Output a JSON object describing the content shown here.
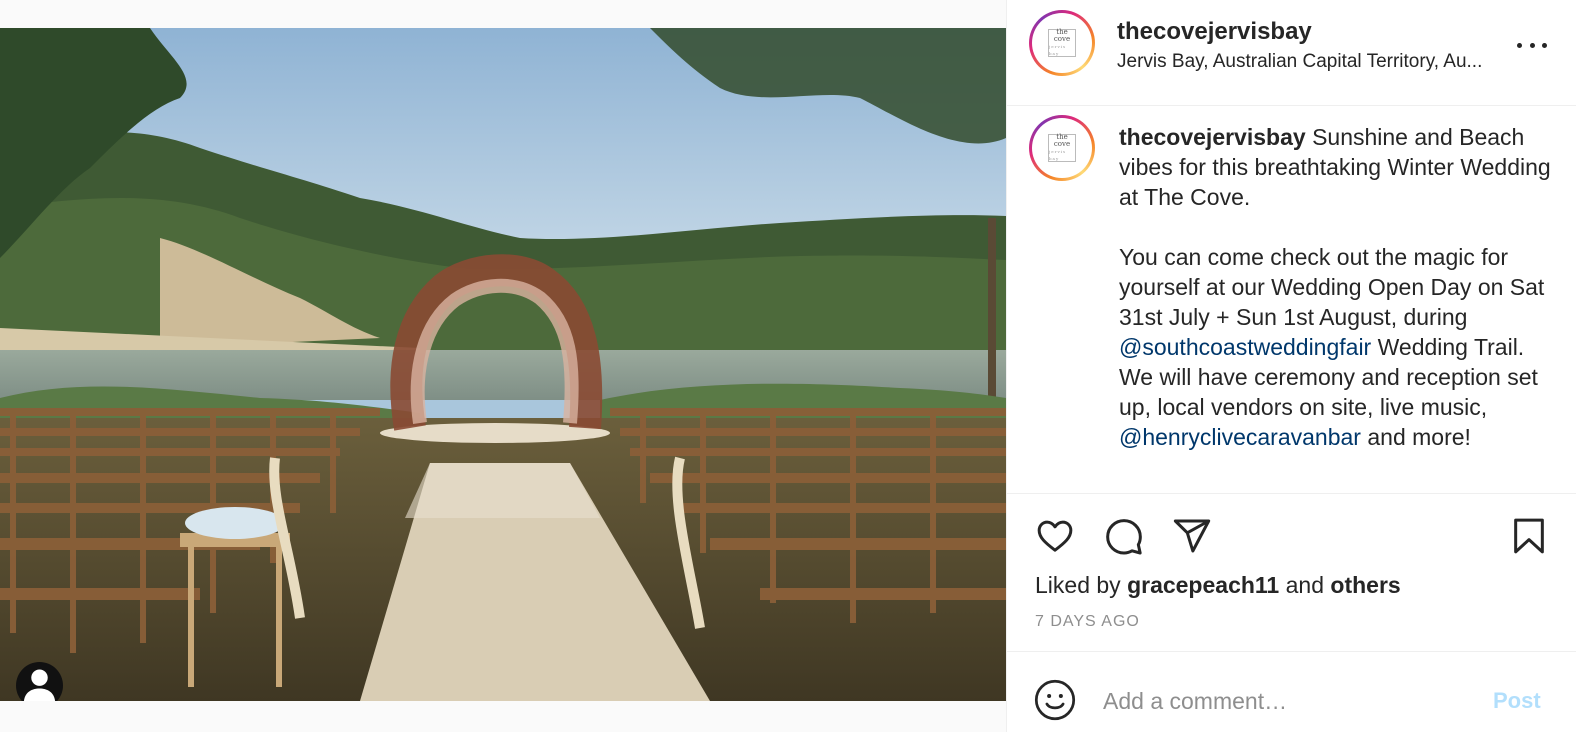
{
  "post": {
    "username": "thecovejervisbay",
    "location": "Jervis Bay, Australian Capital Territory, Au...",
    "avatar_logo_top": "the",
    "avatar_logo_mid": "cove",
    "avatar_logo_sub": "jervis bay"
  },
  "caption": {
    "username": "thecovejervisbay",
    "p1": "Sunshine and Beach vibes for this breathtaking Winter Wedding at The Cove.",
    "p2_a": "You can come check out the magic for yourself at our Wedding Open Day on Sat 31st July + Sun 1st August, during",
    "mention1": "@southcoastweddingfair",
    "p2_b": "Wedding Trail. We will have ceremony and reception set up, local vendors on site, live music,",
    "mention2": "@henryclivecaravanbar",
    "p2_c": "and more!"
  },
  "likes": {
    "prefix": "Liked by",
    "user": "gracepeach11",
    "joiner": "and",
    "others": "others"
  },
  "age": "7 DAYS AGO",
  "comment": {
    "placeholder": "Add a comment…",
    "post_label": "Post"
  },
  "icons": {
    "like": "heart-icon",
    "comment": "comment-bubble-icon",
    "share": "paper-plane-icon",
    "save": "bookmark-icon",
    "emoji": "smiley-icon",
    "more": "ellipsis-icon",
    "tag": "user-tag-icon"
  },
  "colors": {
    "link": "#00376b",
    "post_disabled": "#b2dffc",
    "muted": "#8e8e8e",
    "text": "#262626"
  }
}
